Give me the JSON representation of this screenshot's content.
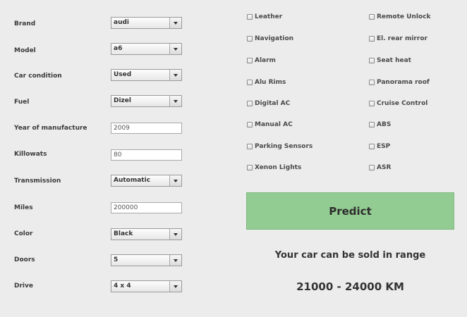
{
  "form": {
    "brand_label": "Brand",
    "brand_value": "audi",
    "model_label": "Model",
    "model_value": "a6",
    "condition_label": "Car condition",
    "condition_value": "Used",
    "fuel_label": "Fuel",
    "fuel_value": "Dizel",
    "year_label": "Year of manufacture",
    "year_value": "2009",
    "kilowatts_label": "Killowats",
    "kilowatts_value": "80",
    "transmission_label": "Transmission",
    "transmission_value": "Automatic",
    "miles_label": "Miles",
    "miles_value": "200000",
    "color_label": "Color",
    "color_value": "Black",
    "doors_label": "Doors",
    "doors_value": "5",
    "drive_label": "Drive",
    "drive_value": "4 x 4"
  },
  "features": {
    "leather": "Leather",
    "remote_unlock": "Remote Unlock",
    "navigation": "Navigation",
    "el_rear_mirror": "El. rear mirror",
    "alarm": "Alarm",
    "seat_heat": "Seat heat",
    "alu_rims": "Alu Rims",
    "panorama_roof": "Panorama roof",
    "digital_ac": "Digital AC",
    "cruise_control": "Cruise Control",
    "manual_ac": "Manual AC",
    "abs": "ABS",
    "parking_sensors": "Parking Sensors",
    "esp": "ESP",
    "xenon_lights": "Xenon Lights",
    "asr": "ASR"
  },
  "actions": {
    "predict_label": "Predict"
  },
  "result": {
    "message": "Your car can be sold in range",
    "range": "21000 - 24000 KM"
  },
  "colors": {
    "predict_button": "#93cc93",
    "background": "#ececec"
  }
}
